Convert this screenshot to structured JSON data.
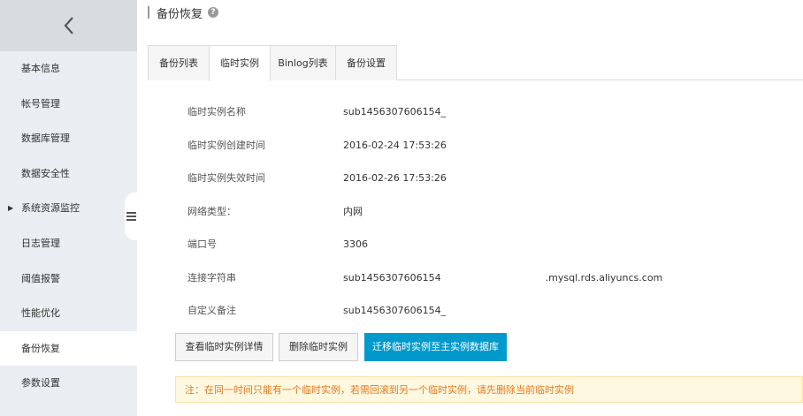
{
  "sidebar": {
    "back_icon": "chevron-left-icon",
    "items": [
      {
        "label": "基本信息"
      },
      {
        "label": "帐号管理"
      },
      {
        "label": "数据库管理"
      },
      {
        "label": "数据安全性"
      },
      {
        "label": "系统资源监控",
        "expandable": true
      },
      {
        "label": "日志管理"
      },
      {
        "label": "阈值报警"
      },
      {
        "label": "性能优化"
      },
      {
        "label": "备份恢复",
        "active": true
      },
      {
        "label": "参数设置"
      }
    ],
    "collapse_icon": "menu-collapse-icon"
  },
  "header": {
    "title": "备份恢复",
    "help_icon": "question-circle-icon",
    "help_glyph": "?"
  },
  "tabs": [
    {
      "label": "备份列表"
    },
    {
      "label": "临时实例",
      "active": true
    },
    {
      "label": "Binlog列表"
    },
    {
      "label": "备份设置"
    }
  ],
  "details": [
    {
      "label": "临时实例名称",
      "value": "sub1456307606154_"
    },
    {
      "label": "临时实例创建时间",
      "value": "2016-02-24 17:53:26"
    },
    {
      "label": "临时实例失效时间",
      "value": "2016-02-26 17:53:26"
    },
    {
      "label": "网络类型：",
      "value": "内网"
    },
    {
      "label": "端口号",
      "value": "3306"
    },
    {
      "label": "连接字符串",
      "value_prefix": "sub1456307606154",
      "value_suffix": ".mysql.rds.aliyuncs.com"
    },
    {
      "label": "自定义备注",
      "value": "sub1456307606154_"
    }
  ],
  "actions": {
    "view_details": "查看临时实例详情",
    "delete": "删除临时实例",
    "migrate": "迁移临时实例至主实例数据库"
  },
  "notice": "注：在同一时间只能有一个临时实例，若需回滚到另一个临时实例，请先删除当前临时实例",
  "colors": {
    "primary": "#0099cc",
    "sidebar_bg": "#eaedf1",
    "notice_bg": "#fff8e1",
    "notice_text": "#e07a1f"
  }
}
